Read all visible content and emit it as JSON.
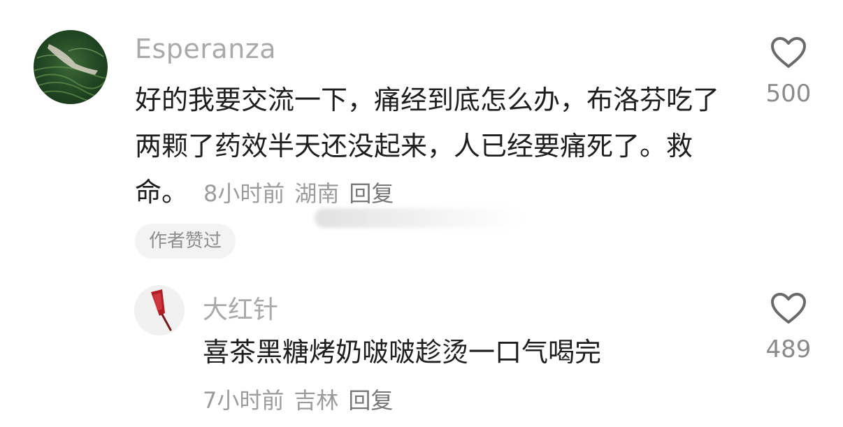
{
  "main_comment": {
    "username": "Esperanza",
    "text": "好的我要交流一下，痛经到底怎么办，布洛芬吃了两颗了药效半天还没起来，人已经要痛死了。救命。",
    "time": "8小时前",
    "location": "湖南",
    "reply_label": "回复",
    "author_liked_label": "作者赞过",
    "likes": "500"
  },
  "reply_comment": {
    "username": "大红针",
    "text": "喜茶黑糖烤奶啵啵趁烫一口气喝完",
    "time": "7小时前",
    "location": "吉林",
    "reply_label": "回复",
    "likes": "489"
  },
  "icons": {
    "like": "heart-outline-icon"
  },
  "colors": {
    "text_primary": "#1e1e1e",
    "text_secondary": "#9c9c9c",
    "username": "#a9a9a9",
    "badge_bg": "#f3f3f3"
  }
}
